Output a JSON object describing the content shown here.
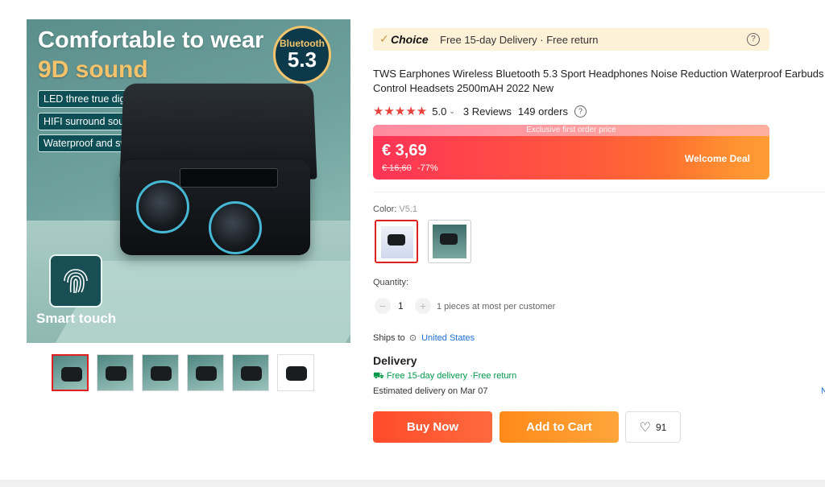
{
  "gallery": {
    "main_image": {
      "headline": "Comfortable to wear",
      "subheadline": "9D sound",
      "badge_top": "Bluetooth",
      "badge_bottom": "5.3",
      "features": [
        "LED three true digital display",
        "HIFI surround sound",
        "Waterproof and sweat"
      ],
      "smart_touch_label": "Smart touch"
    },
    "thumbnails": 6,
    "selected_thumbnail": 1
  },
  "choice": {
    "check": "✓",
    "tag": "Choice",
    "text": "Free 15-day Delivery · Free return",
    "help_icon": "?"
  },
  "product": {
    "title": "TWS Earphones Wireless Bluetooth 5.3 Sport Headphones Noise Reduction Waterproof Earbuds Control Headsets 2500mAH 2022 New",
    "stars": "★★★★★",
    "rating": "5.0",
    "rating_caret": "⌄",
    "reviews": "3 Reviews",
    "orders": "149 orders",
    "orders_help": "?"
  },
  "price": {
    "banner": "Exclusive first order price",
    "current": "€ 3,69",
    "original": "€ 16,60",
    "discount": "-77%",
    "deal_label": "Welcome Deal"
  },
  "color": {
    "label": "Color:",
    "selected": "V5.1"
  },
  "quantity": {
    "label": "Quantity:",
    "minus": "−",
    "value": "1",
    "plus": "+",
    "note": "1 pieces at most per customer"
  },
  "shipping": {
    "label": "Ships to",
    "pin_icon": "⊙",
    "country": "United States"
  },
  "delivery": {
    "title": "Delivery",
    "free": "⛟ Free 15-day delivery ·Free return",
    "estimate": "Estimated delivery on Mar 07",
    "edge_text": "N"
  },
  "actions": {
    "buy_now": "Buy Now",
    "add_to_cart": "Add to Cart",
    "heart_icon": "♡",
    "wishlist_count": "91"
  },
  "colors": {
    "price_gradient_start": "#ff3356",
    "price_gradient_end": "#ff8a1f",
    "buy_button": "#ff4b2b",
    "cart_button": "#ff8a1a",
    "stars": "#e8403a",
    "link": "#1b6fd6",
    "delivery_green": "#00984a"
  }
}
